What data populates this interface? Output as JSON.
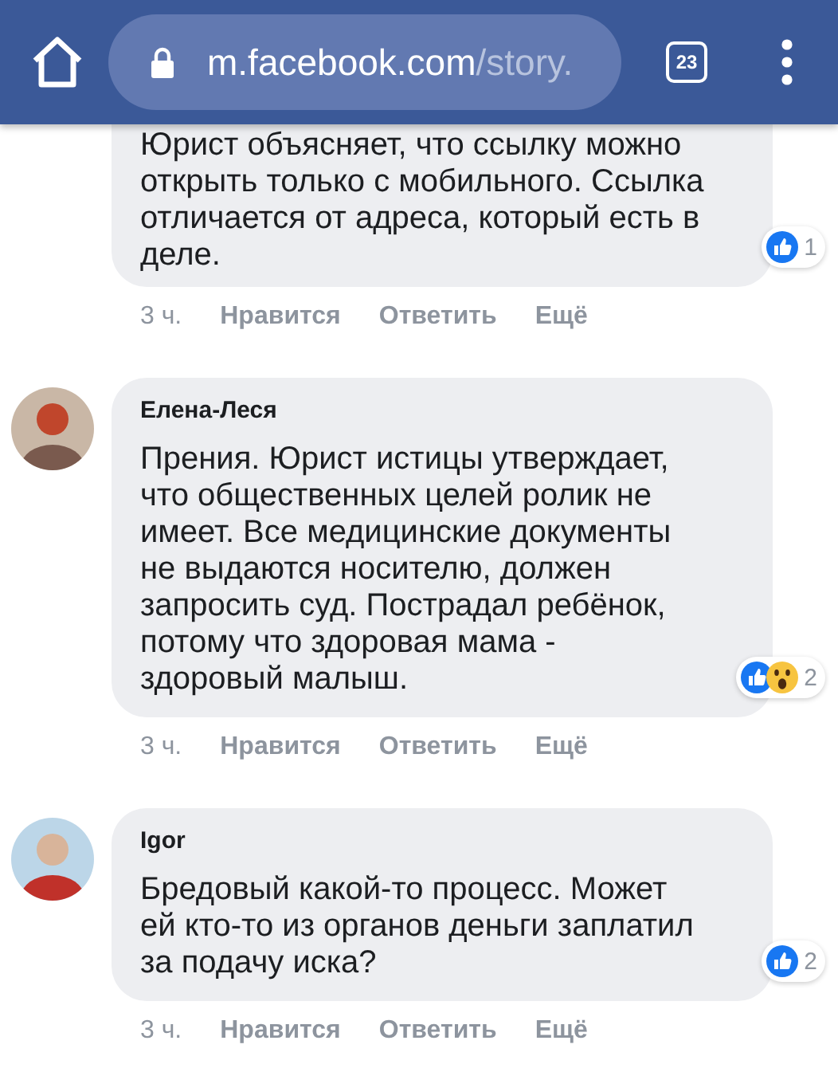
{
  "browser": {
    "url_host": "m.facebook.com",
    "url_path": "/story.",
    "tab_count": "23"
  },
  "comments": [
    {
      "text_lines": [
        "Юрист объясняет, что ссылку можно",
        "открыть только с мобильного. Ссылка",
        "отличается от адреса, который есть в",
        "деле."
      ],
      "reactions": [
        {
          "kind": "like"
        }
      ],
      "reaction_count": "1",
      "time": "3 ч.",
      "actions": [
        "Нравится",
        "Ответить",
        "Ещё"
      ]
    },
    {
      "author": "Елена-Леся",
      "text_lines": [
        "Прения. Юрист истицы утверждает,",
        "что общественных целей ролик не",
        "имеет. Все медицинские документы",
        "не выдаются носителю, должен",
        "запросить суд. Пострадал ребёнок,",
        "потому что здоровая мама -",
        "здоровый малыш."
      ],
      "reactions": [
        {
          "kind": "like"
        },
        {
          "kind": "wow"
        }
      ],
      "reaction_count": "2",
      "time": "3 ч.",
      "actions": [
        "Нравится",
        "Ответить",
        "Ещё"
      ]
    },
    {
      "author": "Igor",
      "text_lines": [
        "Бредовый какой-то процесс. Может",
        "ей кто-то из органов деньги заплатил",
        "за подачу иска?"
      ],
      "reactions": [
        {
          "kind": "like"
        }
      ],
      "reaction_count": "2",
      "time": "3 ч.",
      "actions": [
        "Нравится",
        "Ответить",
        "Ещё"
      ]
    }
  ]
}
